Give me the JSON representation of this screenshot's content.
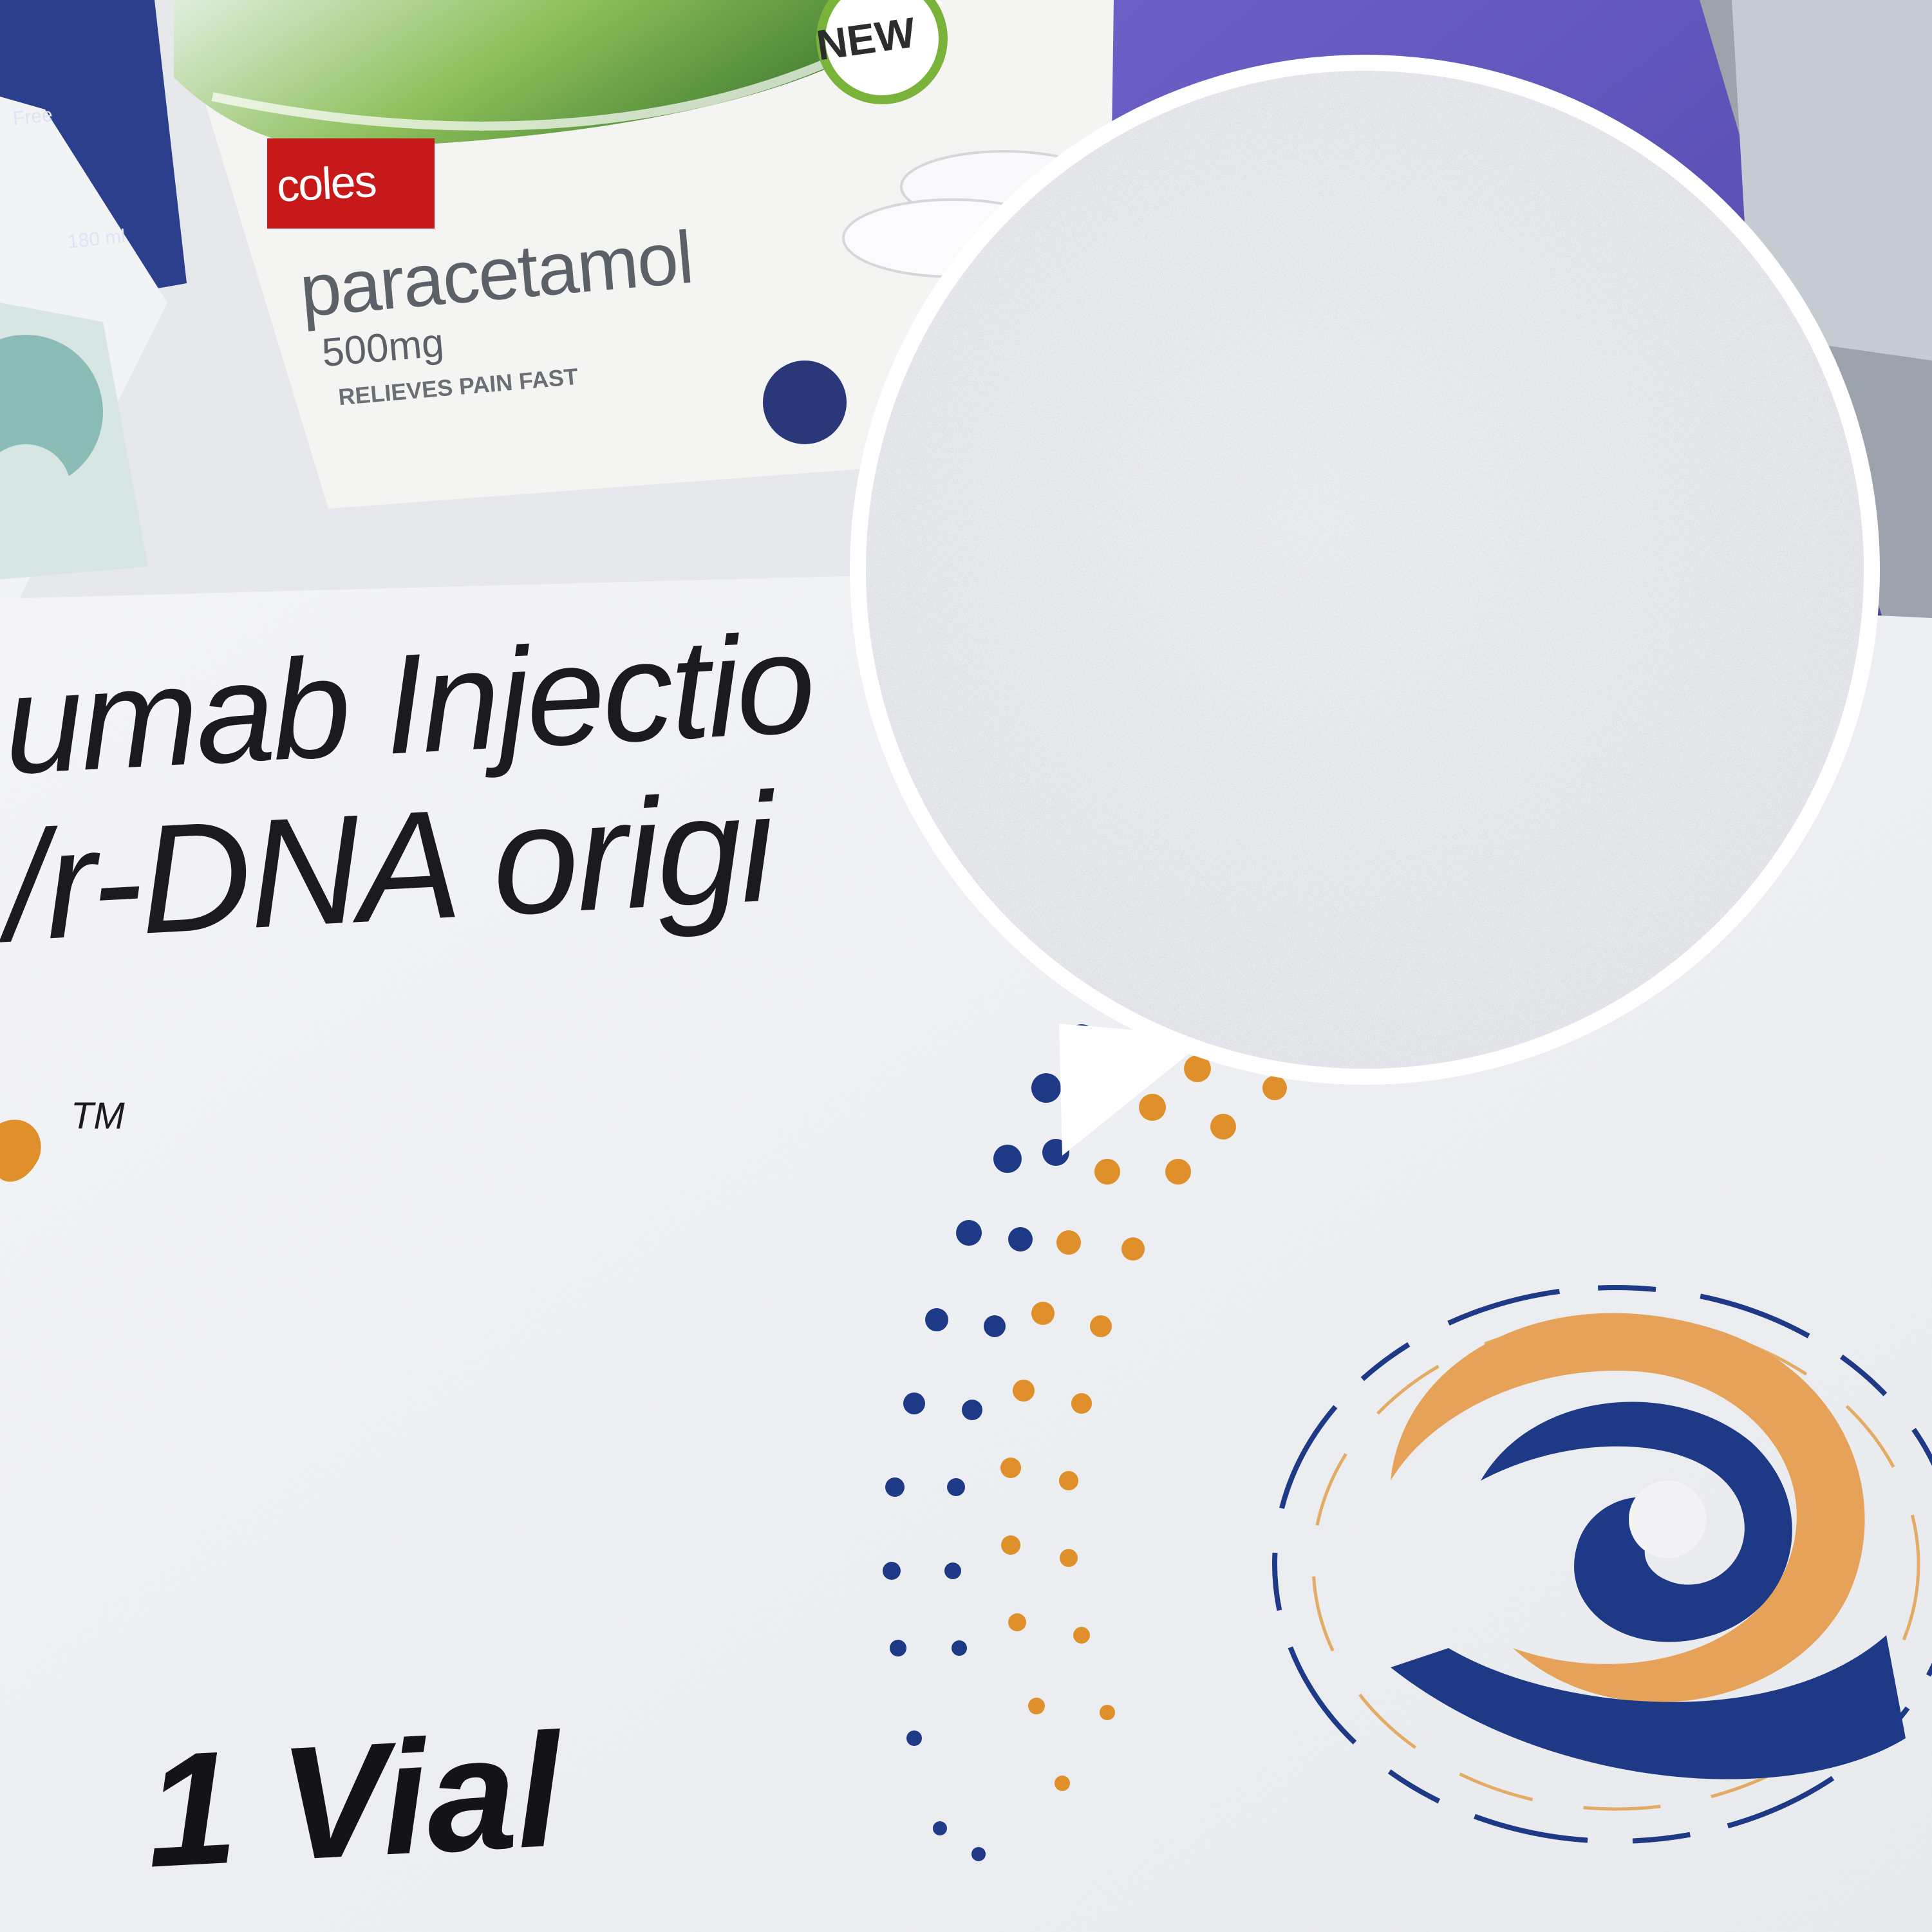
{
  "photo": {
    "coles_box": {
      "brand": "coles",
      "product": "paracetamol",
      "strength": "500mg",
      "claim": "RELIEVES PAIN FAST",
      "badge_new": "NEW"
    },
    "left_box": {
      "frag_free": "Free",
      "frag_volume": "180 ml"
    },
    "pharma_carton": {
      "name_fragment": "umab Injectio",
      "origin_fragment": "/r-DNA origi",
      "trademark": "TM",
      "pack_size": "1 Vial",
      "dot_colors": {
        "navy": "#1e3a86",
        "orange": "#e0902a"
      }
    }
  },
  "magnifier": {
    "subject": "textured matte coating close-up"
  }
}
